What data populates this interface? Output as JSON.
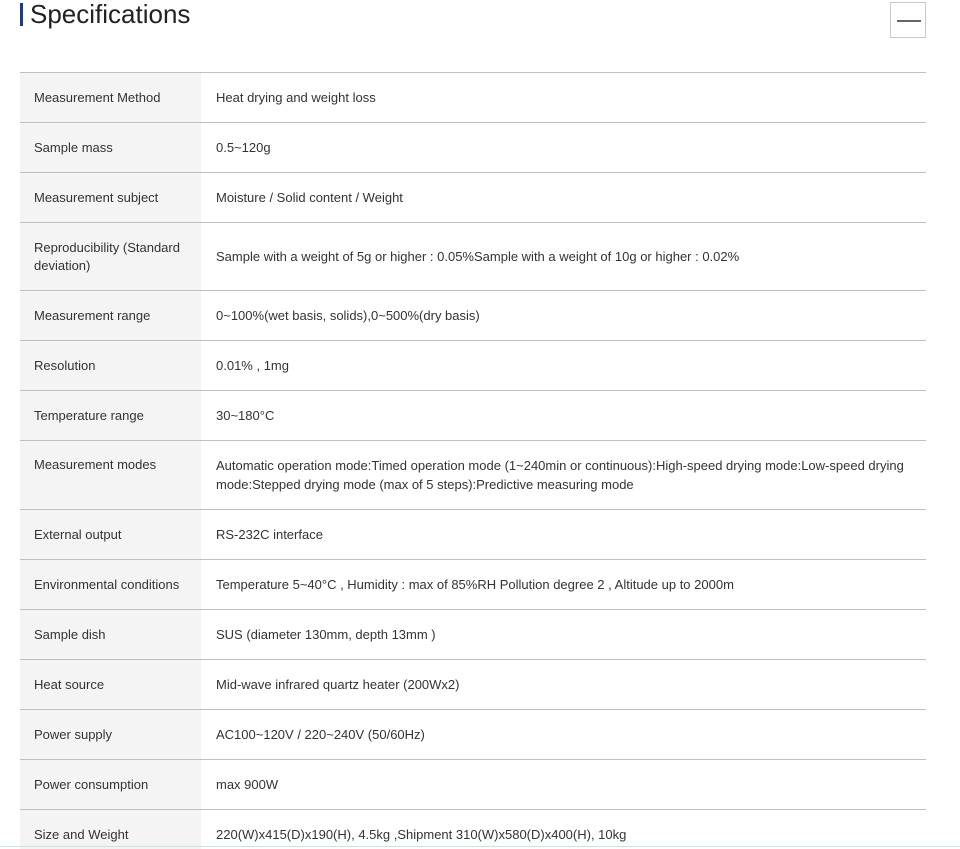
{
  "section": {
    "title": "Specifications",
    "toggle_icon": "minus-icon"
  },
  "specs": [
    {
      "label": "Measurement Method",
      "value": "Heat drying and weight loss"
    },
    {
      "label": "Sample mass",
      "value": "0.5~120g"
    },
    {
      "label": "Measurement subject",
      "value": "Moisture / Solid content / Weight"
    },
    {
      "label": "Reproducibility (Standard deviation)",
      "value": "Sample with a weight of 5g or higher : 0.05%Sample with a weight of 10g or higher : 0.02%"
    },
    {
      "label": "Measurement range",
      "value": "0~100%(wet basis, solids),0~500%(dry basis)"
    },
    {
      "label": "Resolution",
      "value": "0.01% , 1mg"
    },
    {
      "label": "Temperature range",
      "value": "30~180°C"
    },
    {
      "label": "Measurement modes",
      "value": "Automatic operation mode:Timed operation mode (1~240min or continuous):High-speed drying mode:Low-speed drying mode:Stepped drying mode (max of 5 steps):Predictive measuring mode"
    },
    {
      "label": "External output",
      "value": "RS-232C interface"
    },
    {
      "label": "Environmental conditions",
      "value": "Temperature 5~40°C , Humidity : max of 85%RH Pollution degree 2 , Altitude up to 2000m"
    },
    {
      "label": "Sample dish",
      "value": "SUS (diameter 130mm, depth 13mm )"
    },
    {
      "label": "Heat source",
      "value": "Mid-wave infrared quartz heater (200Wx2)"
    },
    {
      "label": "Power supply",
      "value": "AC100~120V / 220~240V (50/60Hz)"
    },
    {
      "label": "Power consumption",
      "value": "max 900W"
    },
    {
      "label": "Size and Weight",
      "value": "220(W)x415(D)x190(H), 4.5kg ,Shipment 310(W)x580(D)x400(H), 10kg"
    }
  ]
}
